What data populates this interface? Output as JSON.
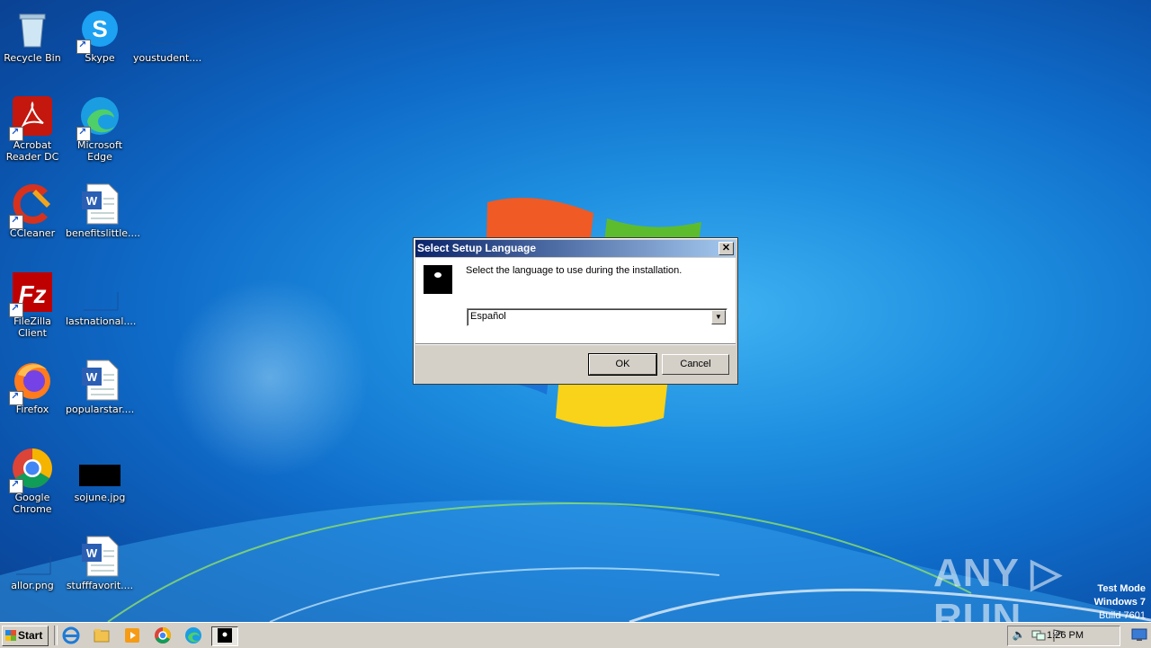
{
  "desktop": {
    "icons": [
      {
        "label": "Recycle Bin"
      },
      {
        "label": "Skype"
      },
      {
        "label": "youstudent...."
      },
      {
        "label": "Acrobat Reader DC"
      },
      {
        "label": "Microsoft Edge"
      },
      {
        "label": "CCleaner"
      },
      {
        "label": "benefitslittle...."
      },
      {
        "label": "FileZilla Client"
      },
      {
        "label": "lastnational...."
      },
      {
        "label": "Firefox"
      },
      {
        "label": "popularstar...."
      },
      {
        "label": "Google Chrome"
      },
      {
        "label": "sojune.jpg"
      },
      {
        "label": "allor.png"
      },
      {
        "label": "stufffavorit...."
      }
    ]
  },
  "dialog": {
    "title": "Select Setup Language",
    "close_label": "✕",
    "prompt": "Select the language to use during the installation.",
    "selected_language": "Español",
    "ok_label": "OK",
    "cancel_label": "Cancel"
  },
  "watermark": {
    "brand": "ANY ▷ RUN",
    "line1": "Test Mode",
    "line2": "Windows 7",
    "line3": "Build 7601"
  },
  "taskbar": {
    "start_label": "Start",
    "clock": "1:26 PM"
  },
  "colors": {
    "titlebar_start": "#0a246a",
    "titlebar_end": "#a6caf0",
    "dialog_face": "#d4d0c8",
    "desktop_blue": "#1e8fe0"
  }
}
